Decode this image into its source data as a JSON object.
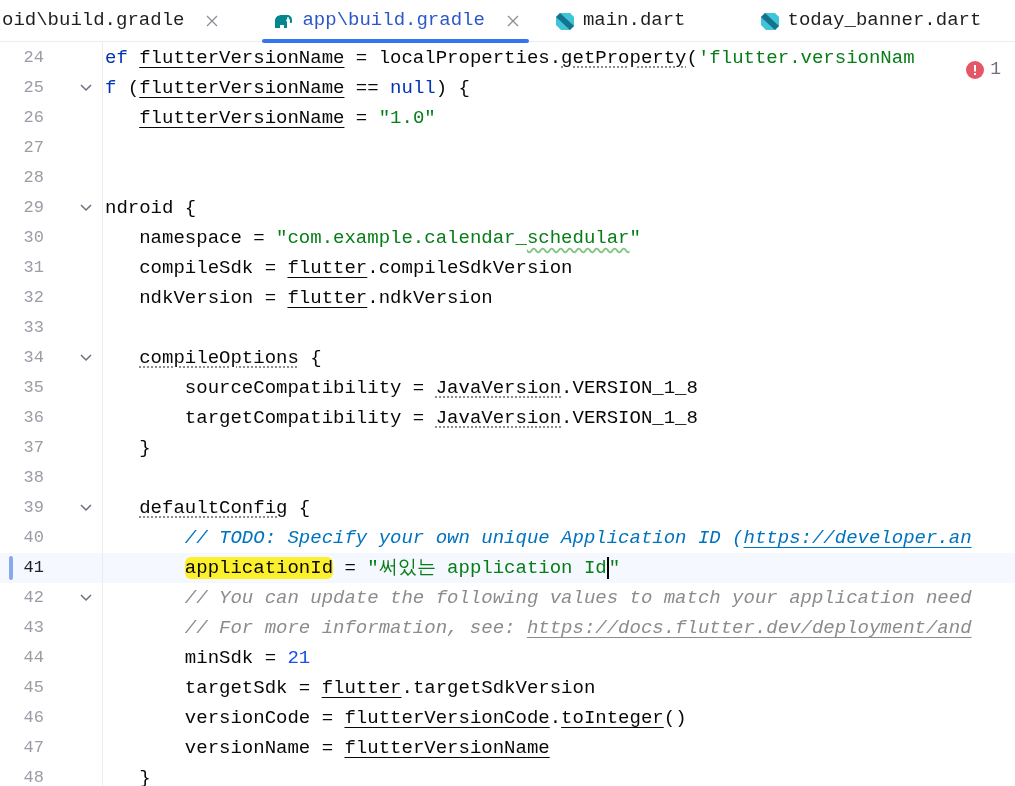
{
  "tabs": [
    {
      "label": "oid\\build.gradle",
      "selected": false,
      "closable": true
    },
    {
      "label": "app\\build.gradle",
      "selected": true,
      "closable": true
    },
    {
      "label": "main.dart",
      "selected": false,
      "closable": false
    },
    {
      "label": "today_banner.dart",
      "selected": false,
      "closable": false
    }
  ],
  "problems": {
    "count": "1"
  },
  "lines": [
    {
      "number": "24",
      "current": false,
      "fold": false,
      "tokens": [
        {
          "kind": "keyword",
          "text": "ef "
        },
        {
          "kind": "ref",
          "text": "flutterVersionName"
        },
        {
          "kind": "text",
          "text": " = localProperties."
        },
        {
          "kind": "warn",
          "text": "getProperty"
        },
        {
          "kind": "text",
          "text": "("
        },
        {
          "kind": "string",
          "text": "'flutter.versionNam"
        }
      ]
    },
    {
      "number": "25",
      "current": false,
      "fold": true,
      "tokens": [
        {
          "kind": "keyword",
          "text": "f"
        },
        {
          "kind": "text",
          "text": " ("
        },
        {
          "kind": "ref",
          "text": "flutterVersionName"
        },
        {
          "kind": "text",
          "text": " == "
        },
        {
          "kind": "keyword",
          "text": "null"
        },
        {
          "kind": "text",
          "text": ") {"
        }
      ]
    },
    {
      "number": "26",
      "current": false,
      "fold": false,
      "tokens": [
        {
          "kind": "ref",
          "text": "   flutterVersionName"
        },
        {
          "kind": "text",
          "text": " = "
        },
        {
          "kind": "string",
          "text": "\"1.0\""
        }
      ]
    },
    {
      "number": "27",
      "current": false,
      "fold": false
    },
    {
      "number": "28",
      "current": false,
      "fold": false
    },
    {
      "number": "29",
      "current": false,
      "fold": true,
      "tokens": [
        {
          "kind": "text",
          "text": "ndroid {"
        }
      ]
    },
    {
      "number": "30",
      "current": false,
      "fold": false,
      "tokens": [
        {
          "kind": "text",
          "text": "   namespace = "
        },
        {
          "kind": "string",
          "text": "\"com.example.calendar_"
        },
        {
          "kind": "typo",
          "text": "schedular"
        },
        {
          "kind": "string",
          "text": "\""
        }
      ]
    },
    {
      "number": "31",
      "current": false,
      "fold": false,
      "tokens": [
        {
          "kind": "text",
          "text": "   compileSdk = "
        },
        {
          "kind": "ref",
          "text": "flutter"
        },
        {
          "kind": "text",
          "text": ".compileSdkVersion"
        }
      ]
    },
    {
      "number": "32",
      "current": false,
      "fold": false,
      "tokens": [
        {
          "kind": "text",
          "text": "   ndkVersion = "
        },
        {
          "kind": "ref",
          "text": "flutter"
        },
        {
          "kind": "text",
          "text": ".ndkVersion"
        }
      ]
    },
    {
      "number": "33",
      "current": false,
      "fold": false
    },
    {
      "number": "34",
      "current": false,
      "fold": true,
      "tokens": [
        {
          "kind": "warn",
          "text": "   compileOptions"
        },
        {
          "kind": "text",
          "text": " {"
        }
      ]
    },
    {
      "number": "35",
      "current": false,
      "fold": false,
      "tokens": [
        {
          "kind": "text",
          "text": "       sourceCompatibility = "
        },
        {
          "kind": "warn",
          "text": "JavaVersion"
        },
        {
          "kind": "text",
          "text": ".VERSION_1_8"
        }
      ]
    },
    {
      "number": "36",
      "current": false,
      "fold": false,
      "tokens": [
        {
          "kind": "text",
          "text": "       targetCompatibility = "
        },
        {
          "kind": "warn",
          "text": "JavaVersion"
        },
        {
          "kind": "text",
          "text": ".VERSION_1_8"
        }
      ]
    },
    {
      "number": "37",
      "current": false,
      "fold": false,
      "tokens": [
        {
          "kind": "text",
          "text": "   }"
        }
      ]
    },
    {
      "number": "38",
      "current": false,
      "fold": false
    },
    {
      "number": "39",
      "current": false,
      "fold": true,
      "tokens": [
        {
          "kind": "warn",
          "text": "   defaultConfig"
        },
        {
          "kind": "text",
          "text": " {"
        }
      ]
    },
    {
      "number": "40",
      "current": false,
      "fold": false,
      "tokens": [
        {
          "kind": "todo",
          "text": "       // TODO: Specify your own unique Application ID ("
        },
        {
          "kind": "todo-link",
          "text": "https://developer.an"
        }
      ]
    },
    {
      "number": "41",
      "current": true,
      "fold": false,
      "tokens": [
        {
          "kind": "highlight",
          "text": "       applicationId"
        },
        {
          "kind": "text",
          "text": " = "
        },
        {
          "kind": "string",
          "text": "\"써있는 application Id",
          "caret": true
        },
        {
          "kind": "string",
          "text": "\""
        }
      ]
    },
    {
      "number": "42",
      "current": false,
      "fold": true,
      "tokens": [
        {
          "kind": "comment",
          "text": "       // You can update the following values to match your application need"
        }
      ]
    },
    {
      "number": "43",
      "current": false,
      "fold": false,
      "tokens": [
        {
          "kind": "comment",
          "text": "       // For more information, see: "
        },
        {
          "kind": "comment-link",
          "text": "https://docs.flutter.dev/deployment/and"
        }
      ]
    },
    {
      "number": "44",
      "current": false,
      "fold": false,
      "tokens": [
        {
          "kind": "text",
          "text": "       minSdk = "
        },
        {
          "kind": "number",
          "text": "21"
        }
      ]
    },
    {
      "number": "45",
      "current": false,
      "fold": false,
      "tokens": [
        {
          "kind": "text",
          "text": "       targetSdk = "
        },
        {
          "kind": "ref",
          "text": "flutter"
        },
        {
          "kind": "text",
          "text": ".targetSdkVersion"
        }
      ]
    },
    {
      "number": "46",
      "current": false,
      "fold": false,
      "tokens": [
        {
          "kind": "text",
          "text": "       versionCode = "
        },
        {
          "kind": "ref",
          "text": "flutterVersionCode"
        },
        {
          "kind": "text",
          "text": "."
        },
        {
          "kind": "ref",
          "text": "toInteger"
        },
        {
          "kind": "text",
          "text": "()"
        }
      ]
    },
    {
      "number": "47",
      "current": false,
      "fold": false,
      "tokens": [
        {
          "kind": "text",
          "text": "       versionName = "
        },
        {
          "kind": "ref",
          "text": "flutterVersionName"
        }
      ]
    },
    {
      "number": "48",
      "current": false,
      "fold": false,
      "tokens": [
        {
          "kind": "text",
          "text": "   }"
        }
      ]
    }
  ]
}
